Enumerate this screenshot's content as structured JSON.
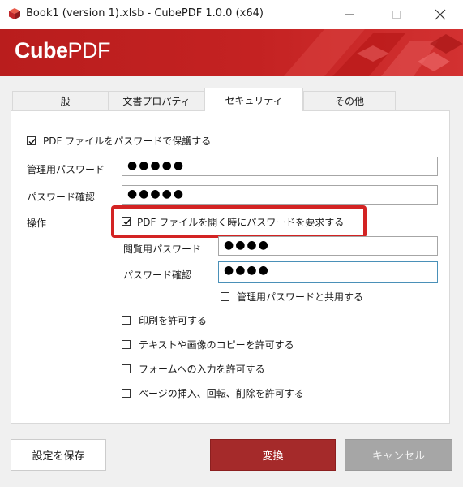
{
  "window": {
    "title": "Book1 (version 1).xlsb - CubePDF 1.0.0 (x64)",
    "minimize": "—",
    "maximize": "☐",
    "close": "✕"
  },
  "banner": {
    "logo_bold": "Cube",
    "logo_regular": "PDF"
  },
  "tabs": [
    {
      "label": "一般"
    },
    {
      "label": "文書プロパティ"
    },
    {
      "label": "セキュリティ",
      "active": true
    },
    {
      "label": "その他"
    }
  ],
  "security": {
    "protect_checkbox": {
      "label": "PDF ファイルをパスワードで保護する",
      "checked": true
    },
    "owner_password": {
      "label": "管理用パスワード",
      "value": "●●●●●"
    },
    "owner_confirm": {
      "label": "パスワード確認",
      "value": "●●●●●"
    },
    "operation_label": "操作",
    "open_password_checkbox": {
      "label": "PDF ファイルを開く時にパスワードを要求する",
      "checked": true
    },
    "user_password": {
      "label": "閲覧用パスワード",
      "value": "●●●●"
    },
    "user_confirm": {
      "label": "パスワード確認",
      "value": "●●●●"
    },
    "share_checkbox": {
      "label": "管理用パスワードと共用する",
      "checked": false
    },
    "permissions": [
      {
        "label": "印刷を許可する",
        "checked": false
      },
      {
        "label": "テキストや画像のコピーを許可する",
        "checked": false
      },
      {
        "label": "フォームへの入力を許可する",
        "checked": false
      },
      {
        "label": "ページの挿入、回転、削除を許可する",
        "checked": false
      }
    ]
  },
  "buttons": {
    "save": "設定を保存",
    "convert": "変換",
    "cancel": "キャンセル"
  },
  "colors": {
    "brand_red": "#c42222",
    "highlight_red": "#d32323",
    "convert_bg": "#a52a2a",
    "cancel_bg": "#a6a6a6"
  }
}
